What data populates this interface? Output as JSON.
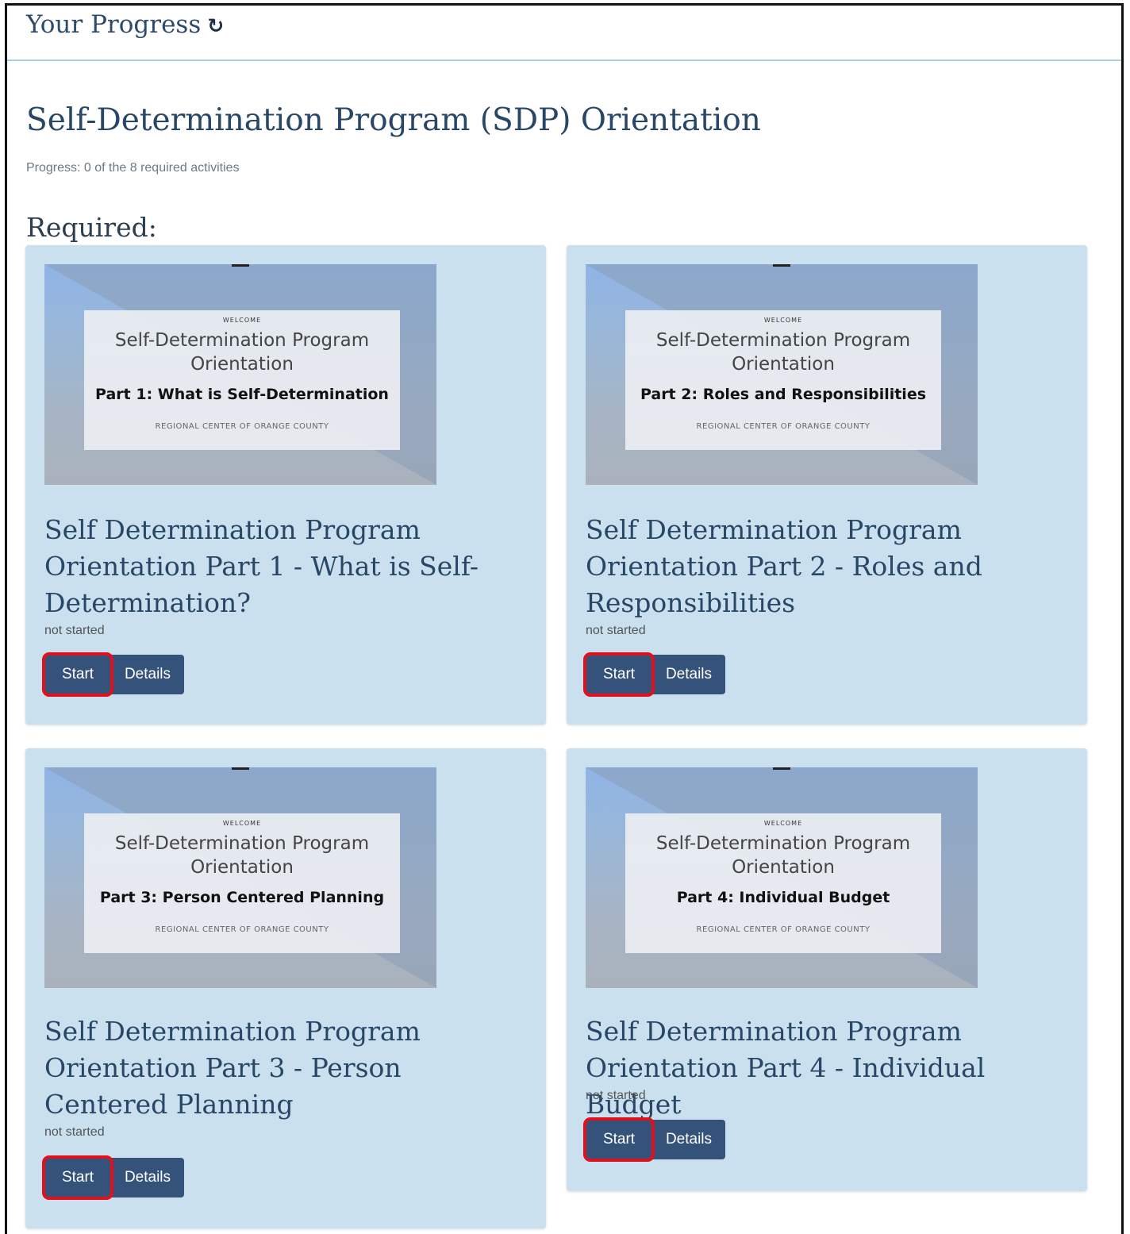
{
  "header": {
    "title": "Your Progress",
    "refresh_icon": "refresh-icon"
  },
  "program": {
    "title": "Self-Determination Program (SDP) Orientation",
    "progress": "Progress: 0 of the 8 required activities",
    "required_label": "Required:"
  },
  "cards": [
    {
      "slide_welcome": "WELCOME",
      "slide_title_line1": "Self-Determination Program",
      "slide_title_line2": "Orientation",
      "slide_part": "Part 1:  What is Self-Determination",
      "slide_org": "REGIONAL CENTER OF ORANGE COUNTY",
      "title": "Self Determination Program Orientation Part 1 - What is Self-Determination?",
      "status": "not started",
      "start_label": "Start",
      "details_label": "Details"
    },
    {
      "slide_welcome": "WELCOME",
      "slide_title_line1": "Self-Determination Program",
      "slide_title_line2": "Orientation",
      "slide_part": "Part 2:  Roles and Responsibilities",
      "slide_org": "REGIONAL CENTER OF ORANGE COUNTY",
      "title": "Self Determination Program Orientation Part 2 - Roles and Responsibilities",
      "status": "not started",
      "start_label": "Start",
      "details_label": "Details"
    },
    {
      "slide_welcome": "WELCOME",
      "slide_title_line1": "Self-Determination Program",
      "slide_title_line2": "Orientation",
      "slide_part": "Part 3:  Person Centered Planning",
      "slide_org": "REGIONAL CENTER OF ORANGE COUNTY",
      "title": "Self Determination Program Orientation Part 3 - Person Centered Planning",
      "status": "not started",
      "start_label": "Start",
      "details_label": "Details"
    },
    {
      "slide_welcome": "WELCOME",
      "slide_title_line1": "Self-Determination Program",
      "slide_title_line2": "Orientation",
      "slide_part": "Part 4:  Individual Budget",
      "slide_org": "REGIONAL CENTER OF ORANGE COUNTY",
      "title": "Self Determination Program Orientation Part 4 - Individual Budget",
      "status": "not started",
      "start_label": "Start",
      "details_label": "Details"
    }
  ],
  "colors": {
    "card_bg": "#cae0ee",
    "button_bg": "#34527a",
    "highlight": "#e0101c",
    "title_text": "#284766"
  }
}
